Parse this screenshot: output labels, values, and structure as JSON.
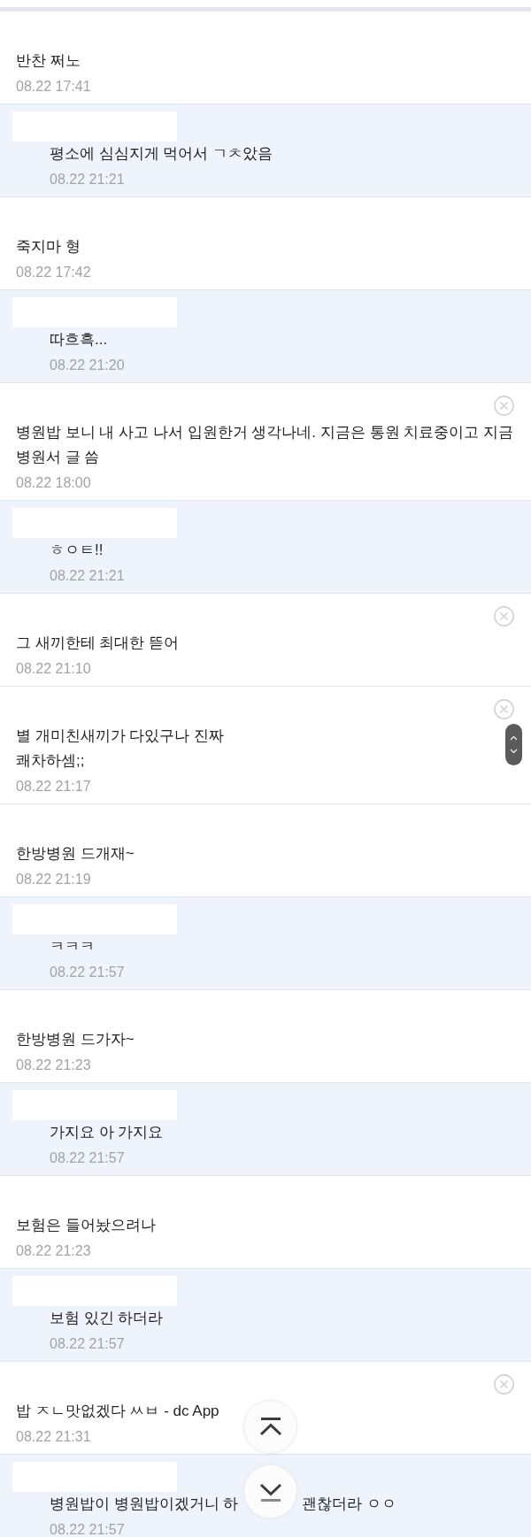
{
  "comments": [
    {
      "kind": "comment",
      "text": "반찬 쩌노",
      "time": "08.22 17:41",
      "delete_button": false
    },
    {
      "kind": "reply",
      "text": "평소에 심심지게 먹어서 ㄱㅊ았음",
      "time": "08.22 21:21",
      "delete_button": false
    },
    {
      "kind": "comment",
      "text": "죽지마 형",
      "time": "08.22 17:42",
      "delete_button": false
    },
    {
      "kind": "reply",
      "text": "따흐흑...",
      "time": "08.22 21:20",
      "delete_button": false
    },
    {
      "kind": "comment",
      "text": "병원밥 보니 내 사고 나서 입원한거 생각나네. 지금은 통원 치료중이고 지금 병원서 글 씀",
      "time": "08.22 18:00",
      "delete_button": true
    },
    {
      "kind": "reply",
      "text": "ㅎㅇㅌ!!",
      "time": "08.22 21:21",
      "delete_button": false
    },
    {
      "kind": "comment",
      "text": "그 새끼한테 최대한 뜯어",
      "time": "08.22 21:10",
      "delete_button": true
    },
    {
      "kind": "comment",
      "text": "별 개미친새끼가 다있구나 진짜\n쾌차하셈;;",
      "time": "08.22 21:17",
      "delete_button": true
    },
    {
      "kind": "comment",
      "text": "한방병원 드개재~",
      "time": "08.22 21:19",
      "delete_button": false
    },
    {
      "kind": "reply",
      "text": "ㅋㅋㅋ",
      "time": "08.22 21:57",
      "delete_button": false
    },
    {
      "kind": "comment",
      "text": "한방병원 드가자~",
      "time": "08.22 21:23",
      "delete_button": false
    },
    {
      "kind": "reply",
      "text": "가지요 아 가지요",
      "time": "08.22 21:57",
      "delete_button": false
    },
    {
      "kind": "comment",
      "text": "보험은 들어놨으려나",
      "time": "08.22 21:23",
      "delete_button": false
    },
    {
      "kind": "reply",
      "text": "보험 있긴 하더라",
      "time": "08.22 21:57",
      "delete_button": false
    },
    {
      "kind": "comment",
      "text": "밥 ㅈㄴ맛없겠다 ㅆㅂ - dc App",
      "time": "08.22 21:31",
      "delete_button": true
    },
    {
      "kind": "reply",
      "text_segments": [
        "병원밥이 병원밥이겠거니 하",
        "괜찮더라 ㅇㅇ"
      ],
      "time": "08.22 21:57",
      "delete_button": false
    }
  ]
}
